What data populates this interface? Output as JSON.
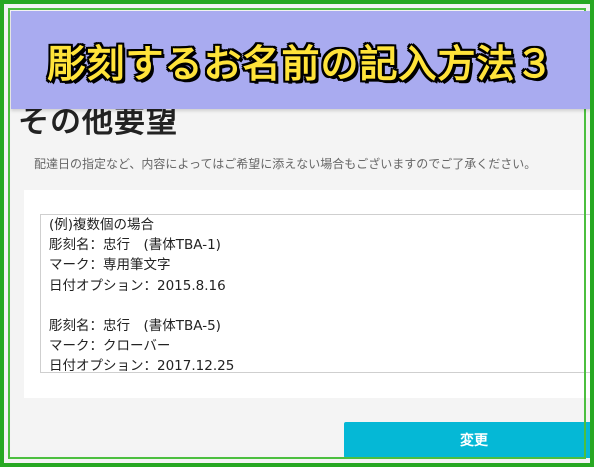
{
  "banner": {
    "title": "彫刻するお名前の記入方法３"
  },
  "section": {
    "title": "その他要望",
    "description": "配達日の指定など、内容によってはご希望に添えない場合もございますのでご了承ください。"
  },
  "textarea": {
    "lines": [
      "(例)複数個の場合",
      "彫刻名：忠行　(書体TBA-1)",
      "マーク：専用筆文字",
      "日付オプション：2015.8.16",
      "",
      "彫刻名：忠行　(書体TBA-5)",
      "マーク：クローバー",
      "日付オプション：2017.12.25"
    ]
  },
  "buttons": {
    "change_label": "変更"
  },
  "colors": {
    "frame": "#27a822",
    "banner_bg": "#a9abf0",
    "banner_text": "#ffe33a",
    "button": "#05b8d6"
  }
}
